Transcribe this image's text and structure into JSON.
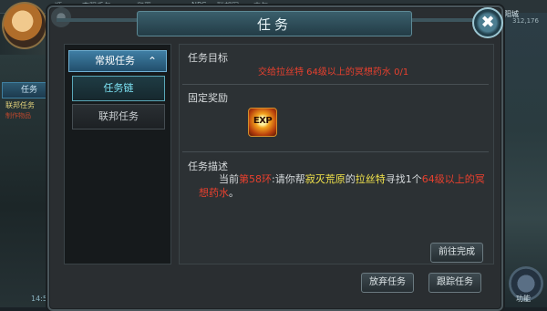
{
  "background": {
    "top_bar_texts": [
      "顺",
      "李阳手包",
      "和平",
      "NPC",
      "联邦军",
      "一",
      "索尔"
    ],
    "left_task_tab": "任务",
    "left_line1": "联邦任务",
    "left_line2": "制作物品",
    "left_bottom_time": "14:5",
    "right_location": "太阳城",
    "right_number": "312,176",
    "right_corner_label": "功能"
  },
  "dialog": {
    "title": "任务",
    "close_label": "✖",
    "categories": {
      "header_label": "常规任务",
      "header_chevron": "⌃",
      "items": [
        {
          "label": "任务链",
          "active": true
        },
        {
          "label": "联邦任务",
          "active": false
        }
      ]
    },
    "content": {
      "goal_label": "任务目标",
      "goal_text": "交给拉丝特 64级以上的冥想药水 0/1",
      "reward_label": "固定奖励",
      "reward_icon": "exp-icon",
      "reward_icon_text": "EXP",
      "desc_label": "任务描述",
      "desc_parts": [
        {
          "text": "当前",
          "color": "white"
        },
        {
          "text": "第58环",
          "color": "red"
        },
        {
          "text": ":请你帮",
          "color": "white"
        },
        {
          "text": "寂灭荒原",
          "color": "yellow"
        },
        {
          "text": "的",
          "color": "white"
        },
        {
          "text": "拉丝特",
          "color": "yellow"
        },
        {
          "text": "寻找1个",
          "color": "white"
        },
        {
          "text": "64级以上的冥想药水",
          "color": "red"
        },
        {
          "text": "。",
          "color": "white"
        }
      ],
      "goto_button": "前往完成"
    },
    "footer": {
      "abandon_button": "放弃任务",
      "track_button": "跟踪任务"
    }
  },
  "colors": {
    "red_text": "#e8402e",
    "yellow_text": "#f4e54b",
    "active_item_text": "#7ee4f5"
  }
}
